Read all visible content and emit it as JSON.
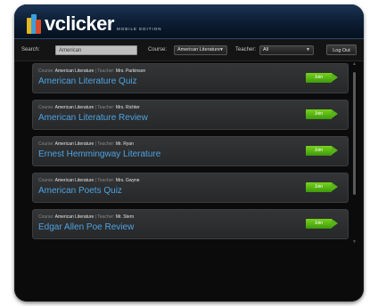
{
  "header": {
    "logo_text": "vclicker",
    "logo_subtitle": "MOBILE EDITION"
  },
  "filters": {
    "search_label": "Search:",
    "search_value": "American",
    "course_label": "Course:",
    "course_value": "American Literature",
    "teacher_label": "Teacher:",
    "teacher_value": "All",
    "logout_label": "Log Out"
  },
  "sessions": [
    {
      "course_label": "Course:",
      "course": "American Literature",
      "separator": " | ",
      "teacher_label": "Teacher:",
      "teacher": "Mrs. Parkinson",
      "title": "American Literature Quiz",
      "join_label": "Join"
    },
    {
      "course_label": "Course:",
      "course": "American Literature",
      "separator": " | ",
      "teacher_label": "Teacher:",
      "teacher": "Mrs. Richter",
      "title": "American Literature Review",
      "join_label": "Join"
    },
    {
      "course_label": "Course:",
      "course": "American Literature",
      "separator": " | ",
      "teacher_label": "Teacher:",
      "teacher": "Mr. Ryan",
      "title": "Ernest Hemmingway Literature",
      "join_label": "Join"
    },
    {
      "course_label": "Course:",
      "course": "American Literature",
      "separator": " | ",
      "teacher_label": "Teacher:",
      "teacher": "Mrs. Gwyne",
      "title": "American Poets Quiz",
      "join_label": "Join"
    },
    {
      "course_label": "Course:",
      "course": "American Literature",
      "separator": " | ",
      "teacher_label": "Teacher:",
      "teacher": "Mr. Stern",
      "title": "Edgar Allen Poe Review",
      "join_label": "Join"
    }
  ],
  "icons": {
    "select_caret": "chevron-down-icon",
    "scroll_up": "triangle-up-icon",
    "scroll_down": "triangle-down-icon"
  },
  "colors": {
    "accent_title": "#4fa3e2",
    "join_button": "#5cba17",
    "header_bg": "#0e2038"
  }
}
